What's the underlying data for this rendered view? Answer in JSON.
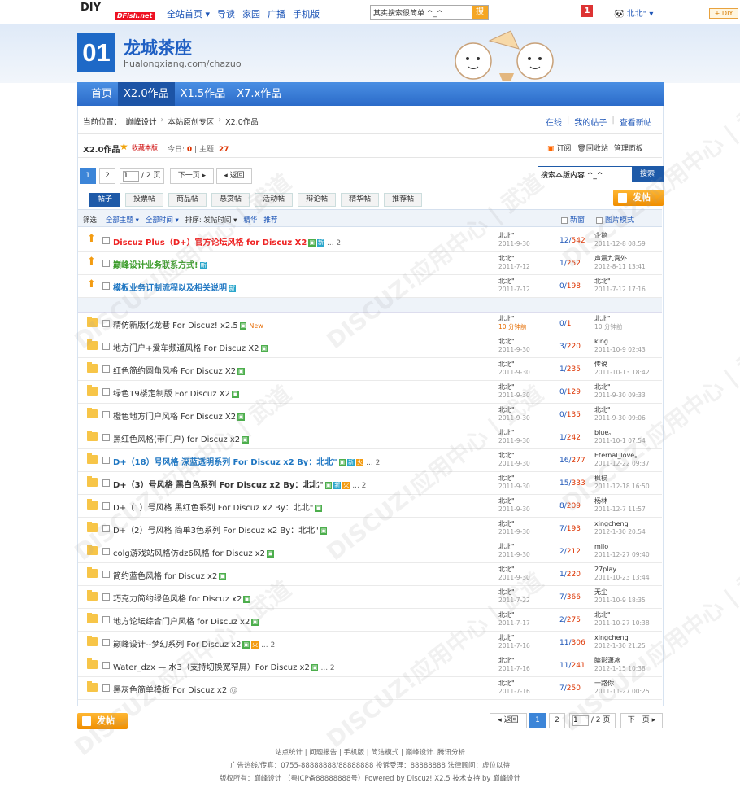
{
  "top": {
    "logo": "DIY",
    "logo_net": "DFish.net",
    "nav": [
      "全站首页 ▾",
      "导读",
      "家园",
      "广播",
      "手机版"
    ],
    "search_value": "其实搜索很简单 ^_^",
    "search_btn": "搜",
    "notice_count": "1",
    "user": "北北\" ▾",
    "diy": "+ DIY"
  },
  "banner": {
    "num": "01",
    "name": "龙城茶座",
    "url": "hualongxiang.com/chazuo"
  },
  "mainnav": [
    "首页",
    "X2.0作品",
    "X1.5作品",
    "X7.x作品"
  ],
  "crumb": [
    "当前位置：",
    "巅峰设计",
    "本站原创专区",
    "X2.0作品"
  ],
  "crumb_right": [
    "在线",
    "我的帖子",
    "查看新帖"
  ],
  "forum": {
    "name": "X2.0作品",
    "fav": "收藏本版",
    "today_label": "今日:",
    "today": "0",
    "topics_label": "主题:",
    "topics": "27",
    "tools": [
      "订阅",
      "回收站",
      "管理面板"
    ]
  },
  "pager": {
    "cur": "1",
    "p2": "2",
    "input": "1",
    "total": "/ 2 页",
    "next": "下一页 ▸",
    "prev": "◂ 返回"
  },
  "search_inner": {
    "placeholder": "搜索本版内容 ^_^",
    "btn": "搜索"
  },
  "post_btn": "发帖",
  "tabs": [
    "帖子",
    "投票帖",
    "商品帖",
    "悬赏帖",
    "活动帖",
    "辩论帖",
    "精华帖",
    "推荐帖"
  ],
  "filter": {
    "label": "筛选:",
    "items": [
      "全部主题 ▾",
      "全部时间 ▾",
      "排序: 发帖时间 ▾",
      "精华",
      "推荐"
    ],
    "newwin": "新窗",
    "imgmode": "图片模式"
  },
  "threads": [
    {
      "title": "Discuz Plus（D+）官方论坛风格 for Discuz X2",
      "style": "t-red",
      "up": true,
      "tags": [
        "img",
        "新"
      ],
      "more": "... 2",
      "author": "北北\"",
      "date": "2011-9-30",
      "reply": "12",
      "view": "542",
      "last": "企鹅",
      "ltime": "2011-12-8 08:59"
    },
    {
      "title": "巅峰设计业务联系方式!",
      "style": "t-green",
      "up": true,
      "tags": [
        "新"
      ],
      "author": "北北\"",
      "date": "2011-7-12",
      "reply": "1",
      "view": "252",
      "last": "声震九霄外",
      "ltime": "2012-8-11 13:41"
    },
    {
      "title": "模板业务订制流程以及相关说明",
      "style": "t-blue",
      "up": true,
      "tags": [
        "新"
      ],
      "author": "北北\"",
      "date": "2011-7-12",
      "reply": "0",
      "view": "198",
      "last": "北北\"",
      "ltime": "2011-7-12 17:16"
    },
    {
      "title": "精仿新版化龙巷 For Discuz! x2.5",
      "style": "",
      "tags": [
        "img"
      ],
      "newtag": "New",
      "author": "北北\"",
      "date": "10 分钟前",
      "datered": true,
      "reply": "0",
      "view": "1",
      "last": "北北\"",
      "ltime": "10 分钟前"
    },
    {
      "title": "地方门户+爱车频道风格 For Discuz X2",
      "style": "",
      "tags": [
        "img"
      ],
      "author": "北北\"",
      "date": "2011-9-30",
      "reply": "3",
      "view": "220",
      "last": "king",
      "ltime": "2011-10-9 02:43"
    },
    {
      "title": "红色简约圆角风格 For Discuz X2",
      "style": "",
      "tags": [
        "img"
      ],
      "author": "北北\"",
      "date": "2011-9-30",
      "reply": "1",
      "view": "235",
      "last": "传说",
      "ltime": "2011-10-13 18:42"
    },
    {
      "title": "绿色19楼定制版 For Discuz X2",
      "style": "",
      "tags": [
        "img"
      ],
      "author": "北北\"",
      "date": "2011-9-30",
      "reply": "0",
      "view": "129",
      "last": "北北\"",
      "ltime": "2011-9-30 09:33"
    },
    {
      "title": "橙色地方门户风格 For Discuz X2",
      "style": "",
      "tags": [
        "img"
      ],
      "author": "北北\"",
      "date": "2011-9-30",
      "reply": "0",
      "view": "135",
      "last": "北北\"",
      "ltime": "2011-9-30 09:06"
    },
    {
      "title": "黑红色风格(带门户) for Discuz x2",
      "style": "",
      "tags": [
        "img"
      ],
      "author": "北北\"",
      "date": "2011-9-30",
      "reply": "1",
      "view": "242",
      "last": "blue。",
      "ltime": "2011-10-1 07:54"
    },
    {
      "title": "D+（18）号风格 深蓝透明系列 For Discuz x2 By：北北\"",
      "style": "t-blue",
      "tags": [
        "img",
        "新",
        "火"
      ],
      "more": "... 2",
      "author": "北北\"",
      "date": "2011-9-30",
      "reply": "16",
      "view": "277",
      "last": "Eternal_love。",
      "ltime": "2011-12-22 09:37"
    },
    {
      "title": "D+（3）号风格 黑白色系列 For Discuz x2 By：北北\"",
      "style": "t-bold",
      "tags": [
        "img",
        "新",
        "火"
      ],
      "more": "... 2",
      "author": "北北\"",
      "date": "2011-9-30",
      "reply": "15",
      "view": "333",
      "last": "枫棂",
      "ltime": "2011-12-18 16:50"
    },
    {
      "title": "D+（1）号风格 黑红色系列 For Discuz x2 By：北北\"",
      "style": "",
      "tags": [
        "img"
      ],
      "author": "北北\"",
      "date": "2011-9-30",
      "reply": "8",
      "view": "209",
      "last": "杨林",
      "ltime": "2011-12-7 11:57"
    },
    {
      "title": "D+（2）号风格 简单3色系列 For Discuz x2 By：北北\"",
      "style": "",
      "tags": [
        "img"
      ],
      "author": "北北\"",
      "date": "2011-9-30",
      "reply": "7",
      "view": "193",
      "last": "xingcheng",
      "ltime": "2012-1-30 20:54"
    },
    {
      "title": "colg游戏站风格仿dz6风格 for Discuz x2",
      "style": "",
      "tags": [
        "img"
      ],
      "author": "北北\"",
      "date": "2011-9-30",
      "reply": "2",
      "view": "212",
      "last": "milo",
      "ltime": "2011-12-27 09:40"
    },
    {
      "title": "简约蓝色风格 for Discuz x2",
      "style": "",
      "tags": [
        "img"
      ],
      "author": "北北\"",
      "date": "2011-9-30",
      "reply": "1",
      "view": "220",
      "last": "27play",
      "ltime": "2011-10-23 13:44"
    },
    {
      "title": "巧克力简约绿色风格 for Discuz x2",
      "style": "",
      "tags": [
        "img"
      ],
      "author": "北北\"",
      "date": "2011-7-22",
      "reply": "7",
      "view": "366",
      "last": "无尘",
      "ltime": "2011-10-9 18:35"
    },
    {
      "title": "地方论坛综合门户风格 for Discuz x2",
      "style": "",
      "tags": [
        "img"
      ],
      "author": "北北\"",
      "date": "2011-7-17",
      "reply": "2",
      "view": "275",
      "last": "北北\"",
      "ltime": "2011-10-27 10:38"
    },
    {
      "title": "巅峰设计--梦幻系列 For Discuz x2",
      "style": "",
      "tags": [
        "img",
        "火"
      ],
      "more": "... 2",
      "author": "北北\"",
      "date": "2011-7-16",
      "reply": "11",
      "view": "306",
      "last": "xingcheng",
      "ltime": "2012-1-30 21:25"
    },
    {
      "title": "Water_dzx — 水3（支持切换宽窄屏）For Discuz x2",
      "style": "",
      "tags": [
        "img"
      ],
      "more": "... 2",
      "author": "北北\"",
      "date": "2011-7-16",
      "reply": "11",
      "view": "241",
      "last": "瞌影潇冰",
      "ltime": "2012-1-15 10:38"
    },
    {
      "title": "黑灰色简单模板 For Discuz x2",
      "style": "",
      "tags": [
        "clip"
      ],
      "author": "北北\"",
      "date": "2011-7-16",
      "reply": "7",
      "view": "250",
      "last": "一路你",
      "ltime": "2011-11-27 00:25"
    }
  ],
  "footer": {
    "line1": "站点统计 | 问题报告 | 手机版 | 简洁模式 | 巅峰设计. 腾讯分析",
    "line2": "广告热线/传真：0755-88888888/88888888   投诉受理：88888888 法律顾问：虚位以待",
    "line3": "版权所有：巅峰设计  （粤ICP备88888888号）Powered by Discuz! X2.5  技术支持 by 巅峰设计"
  },
  "watermark": "DISCUZ!应用中心 | 武道"
}
